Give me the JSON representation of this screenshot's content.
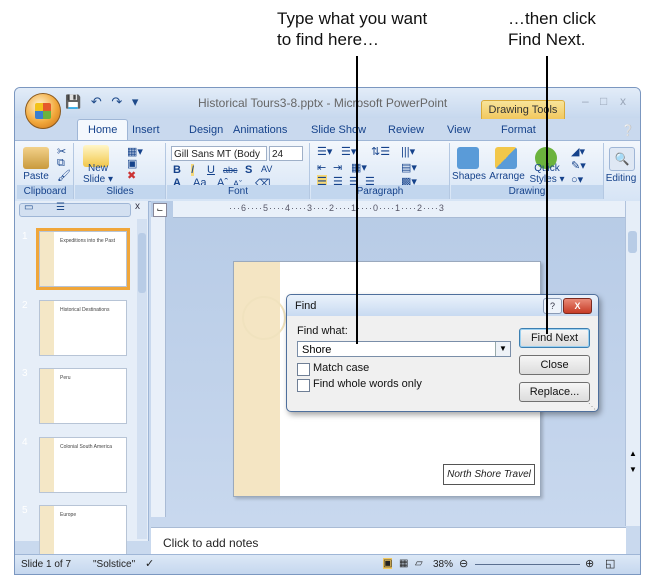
{
  "callouts": {
    "find_hint_line1": "Type what you want",
    "find_hint_line2": "to find here…",
    "next_hint_line1": "…then click",
    "next_hint_line2": "Find Next."
  },
  "window": {
    "title": "Historical Tours3-8.pptx - Microsoft PowerPoint",
    "contextual_tab": "Drawing Tools",
    "controls": {
      "minimize": "–",
      "maximize": "□",
      "close": "x"
    }
  },
  "tabs": [
    "Home",
    "Insert",
    "Design",
    "Animations",
    "Slide Show",
    "Review",
    "View",
    "Format"
  ],
  "ribbon": {
    "paste": "Paste",
    "new_slide_1": "New",
    "new_slide_2": "Slide ▾",
    "font_name": "Gill Sans MT (Body",
    "font_size": "24",
    "shapes": "Shapes",
    "arrange": "Arrange",
    "quick_styles_1": "Quick",
    "quick_styles_2": "Styles ▾",
    "editing": "Editing",
    "groups": {
      "clipboard": "Clipboard",
      "slides": "Slides",
      "font": "Font",
      "paragraph": "Paragraph",
      "drawing": "Drawing"
    }
  },
  "ruler_text": "···6····5····4····3····2····1····0····1····2····3",
  "thumbnails": [
    {
      "num": "1",
      "text": "Expeditions into the Past"
    },
    {
      "num": "2",
      "text": "Historical Destinations"
    },
    {
      "num": "3",
      "text": "Peru"
    },
    {
      "num": "4",
      "text": "Colonial South America"
    },
    {
      "num": "5",
      "text": "Europe"
    }
  ],
  "slide_textbox": "North Shore Travel",
  "notes_placeholder": "Click to add notes",
  "status": {
    "slide": "Slide 1 of 7",
    "theme": "\"Solstice\"",
    "zoom": "38%"
  },
  "find_dialog": {
    "title": "Find",
    "help": "?",
    "close": "X",
    "find_what_label": "Find what:",
    "find_what_value": "Shore",
    "match_case": "Match case",
    "whole_words": "Find whole words only",
    "find_next": "Find Next",
    "close_button": "Close",
    "replace": "Replace..."
  }
}
